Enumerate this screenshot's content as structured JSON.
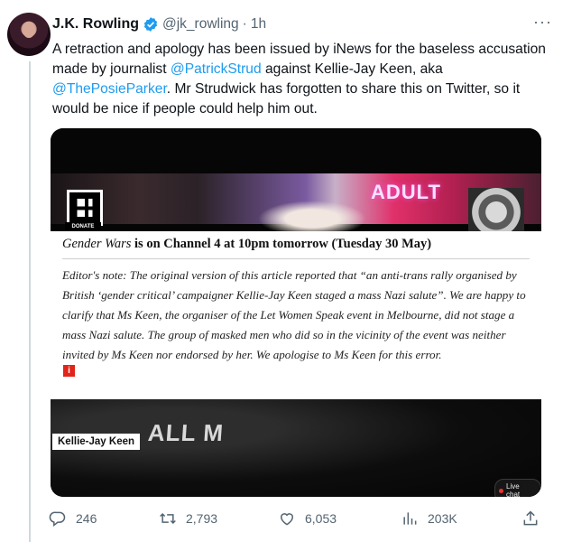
{
  "author": {
    "name": "J.K. Rowling",
    "handle": "@jk_rowling",
    "separator": "·",
    "time": "1h"
  },
  "more_label": "···",
  "tweet_text": {
    "part1": "A retraction and apology has been issued by iNews for the baseless accusation made by journalist ",
    "mention1": "@PatrickStrud",
    "part2": " against Kellie-Jay Keen, aka ",
    "mention2": "@ThePosieParker",
    "part3": ". Mr Strudwick has forgotten to share this on Twitter, so it would be nice if people could help him out."
  },
  "media": {
    "neon_sign": "ADULT",
    "donate_label": "DONATE",
    "headline_italic": "Gender Wars",
    "headline_rest": " is on Channel 4 at 10pm tomorrow (Tuesday 30 May)",
    "editors_note": "Editor's note: The original version of this article reported that “an anti-trans rally organised by British ‘gender critical’ campaigner Kellie-Jay Keen staged a mass Nazi salute”. We are happy to clarify that Ms Keen, the organiser of the Let Women Speak event in Melbourne, did not stage a mass Nazi salute. The group of masked men who did so in the vicinity of the event was neither invited by Ms Keen nor endorsed by her. We apologise to Ms Keen for this error.",
    "i_badge": "i",
    "bottom_sign": "ALL M",
    "caption": "Kellie-Jay Keen",
    "live_label": "Live chat"
  },
  "actions": {
    "replies": "246",
    "retweets": "2,793",
    "likes": "6,053",
    "views": "203K"
  },
  "colors": {
    "accent": "#1d9bf0",
    "muted": "#536471",
    "text": "#0f1419"
  }
}
